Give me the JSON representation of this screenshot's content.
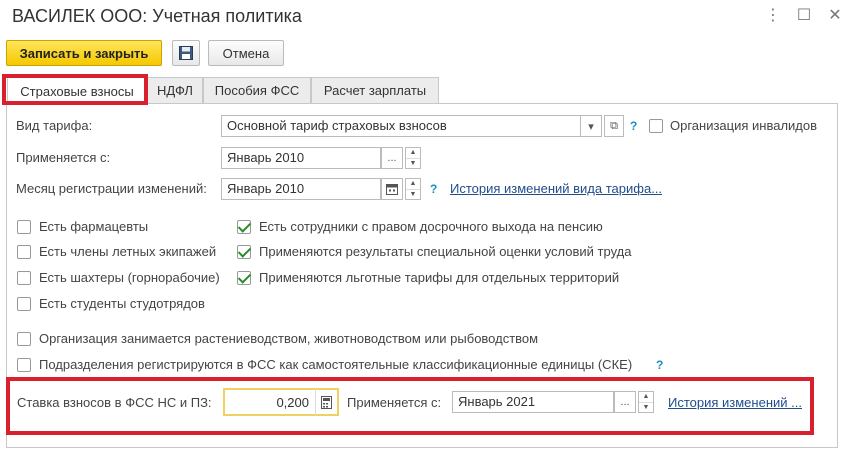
{
  "window": {
    "title": "ВАСИЛЕК ООО: Учетная политика",
    "menu_glyph": "⋮",
    "maximize_glyph": "☐",
    "close_glyph": "✕"
  },
  "toolbar": {
    "save_close_label": "Записать и закрыть",
    "cancel_label": "Отмена"
  },
  "tabs": [
    {
      "label": "Страховые взносы",
      "active": true
    },
    {
      "label": "НДФЛ",
      "active": false
    },
    {
      "label": "Пособия ФСС",
      "active": false
    },
    {
      "label": "Расчет зарплаты",
      "active": false
    }
  ],
  "form": {
    "tariff_label": "Вид тарифа:",
    "tariff_value": "Основной тариф страховых взносов",
    "disabled_org_label": "Организация инвалидов",
    "applies_from_label": "Применяется с:",
    "applies_from_value": "Январь 2010",
    "reg_month_label": "Месяц регистрации изменений:",
    "reg_month_value": "Январь 2010",
    "tariff_history_link": "История изменений вида тарифа...",
    "help_mark": "?",
    "ellipsis": "...",
    "spin_up": "▲",
    "spin_down": "▼",
    "dropdown_glyph": "▾",
    "open_glyph": "⧉"
  },
  "checkboxes_left": [
    {
      "label": "Есть фармацевты",
      "checked": false
    },
    {
      "label": "Есть члены летных экипажей",
      "checked": false
    },
    {
      "label": "Есть шахтеры (горнорабочие)",
      "checked": false
    },
    {
      "label": "Есть студенты студотрядов",
      "checked": false
    }
  ],
  "checkboxes_right": [
    {
      "label": "Есть сотрудники с правом досрочного выхода на пенсию",
      "checked": true
    },
    {
      "label": "Применяются результаты специальной оценки условий труда",
      "checked": true
    },
    {
      "label": "Применяются льготные тарифы для отдельных территорий",
      "checked": true
    }
  ],
  "checkboxes_wide": [
    {
      "label": "Организация занимается растениеводством, животноводством или рыбоводством",
      "checked": false
    },
    {
      "label": "Подразделения регистрируются в ФСС как самостоятельные классификационные единицы (СКЕ)",
      "checked": false
    }
  ],
  "fss": {
    "rate_label": "Ставка взносов в ФСС НС и ПЗ:",
    "rate_value": "0,200",
    "applies_label": "Применяется с:",
    "applies_value": "Январь 2021",
    "history_link": "История изменений ..."
  },
  "colors": {
    "primary_button": "#f5c800",
    "highlight_border": "#d8202e",
    "link": "#1f4d8c",
    "help": "#1a8fbf",
    "check": "#2e8b2e"
  }
}
